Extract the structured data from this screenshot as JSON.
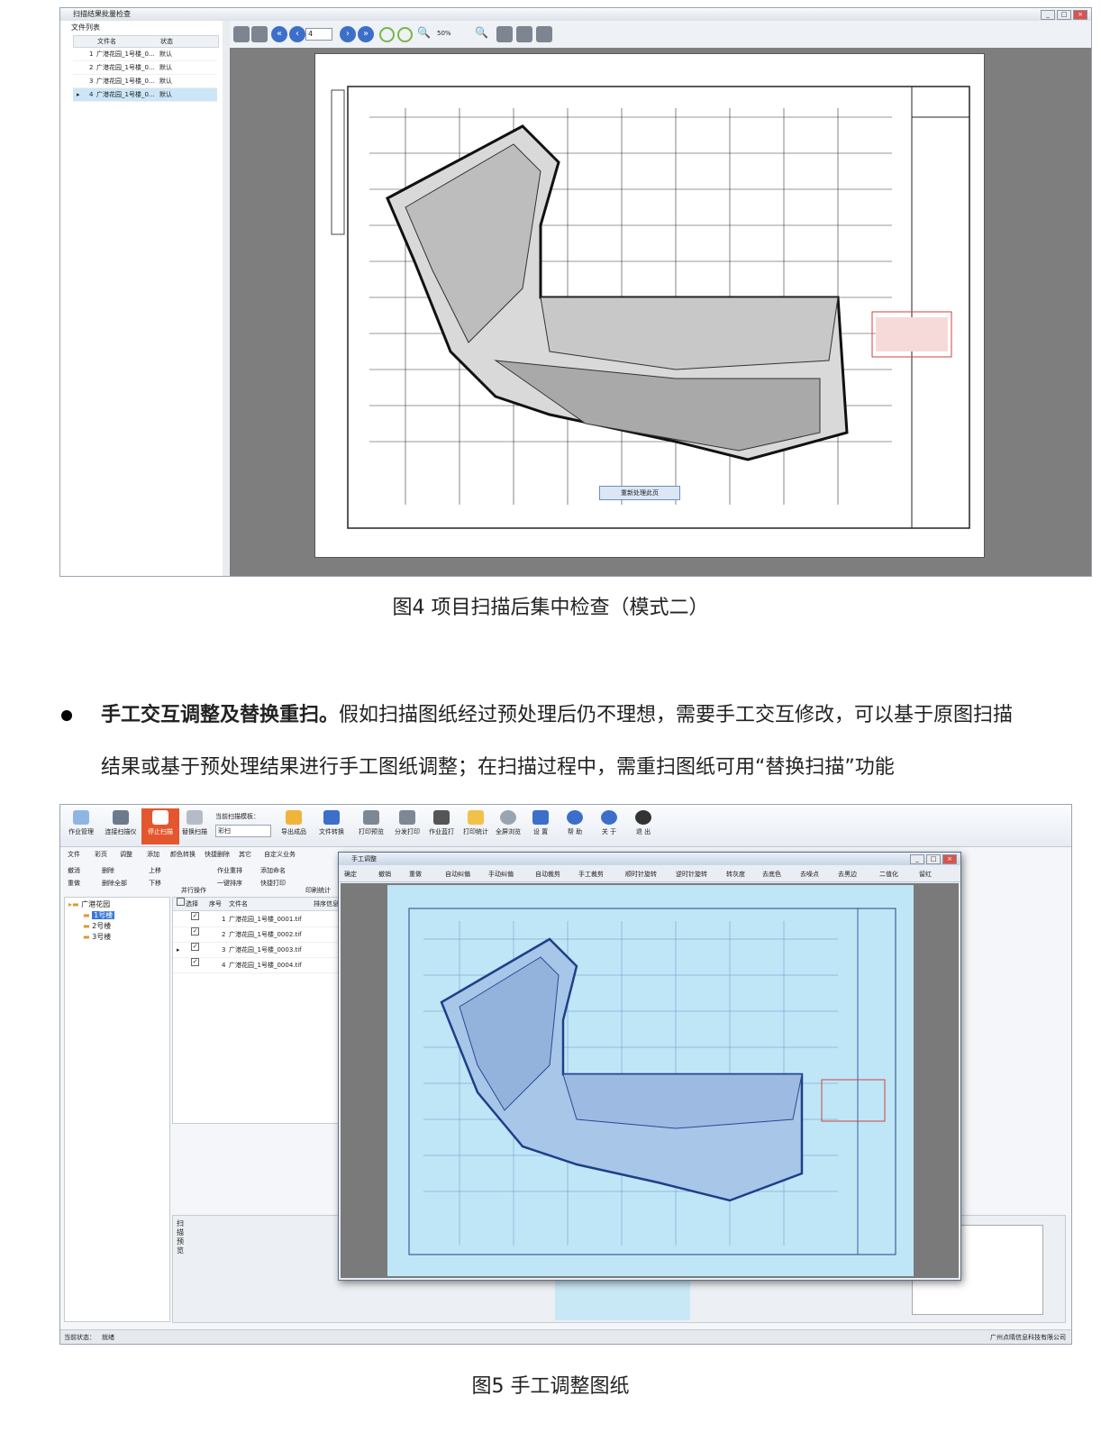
{
  "figure4": {
    "window_title": "扫描结果批量检查",
    "file_list_title": "文件列表",
    "columns": [
      "文件名",
      "状态"
    ],
    "rows": [
      {
        "no": "1",
        "name": "广港花园_1号楼_0...",
        "status": "默认"
      },
      {
        "no": "2",
        "name": "广港花园_1号楼_0...",
        "status": "默认"
      },
      {
        "no": "3",
        "name": "广港花园_1号楼_0...",
        "status": "默认"
      },
      {
        "no": "4",
        "name": "广港花园_1号楼_0...",
        "status": "默认"
      }
    ],
    "page_number": "4",
    "zoom": "50%",
    "context_button": "重新处理此页",
    "caption": "图4  项目扫描后集中检查（模式二）"
  },
  "paragraph": {
    "bold": "手工交互调整及替换重扫。",
    "line1": "假如扫描图纸经过预处理后仍不理想，需要手工交互修改，可以基于原图扫描",
    "line2": "结果或基于预处理结果进行手工图纸调整；在扫描过程中，需重扫图纸可用“替换扫描”功能"
  },
  "figure5": {
    "ribbon": [
      "作业管理",
      "连接扫描仪",
      "停止扫描",
      "替换扫描",
      "当前扫描模板：",
      "导出成品",
      "文件转换",
      "打印预览",
      "分发打印",
      "作业蓝打",
      "打印统计",
      "全屏浏览",
      "设 置",
      "帮 助",
      "关 于",
      "退 出"
    ],
    "template_value": "彩扫",
    "menu": [
      "文件",
      "彩页",
      "调整",
      "添加",
      "颜色转换",
      "快捷删除",
      "其它",
      "自定义业务"
    ],
    "ops": [
      "撤消",
      "删除",
      "上移",
      "作业重排",
      "添加命名",
      "重做",
      "删除全部",
      "下移",
      "并行操作",
      "一键排序",
      "快捷打印",
      "印刷统计"
    ],
    "tree": {
      "root": "广港花园",
      "children": [
        "1号楼",
        "2号楼",
        "3号楼"
      ]
    },
    "grid_columns": [
      "选择",
      "序号",
      "文件名",
      "排序信息"
    ],
    "files": [
      {
        "no": "1",
        "name": "广港花园_1号楼_0001.tif"
      },
      {
        "no": "2",
        "name": "广港花园_1号楼_0002.tif"
      },
      {
        "no": "3",
        "name": "广港花园_1号楼_0003.tif"
      },
      {
        "no": "4",
        "name": "广港花园_1号楼_0004.tif"
      }
    ],
    "preview_label": "扫描预览",
    "dialog_title": "手工调整",
    "dialog_tools": [
      "确定",
      "撤销",
      "重做",
      "自动纠偏",
      "手动纠偏",
      "自动裁剪",
      "手工裁剪",
      "顺时针旋转",
      "逆时针旋转",
      "转灰度",
      "去底色",
      "去噪点",
      "去黑边",
      "二值化",
      "留红"
    ],
    "status_label": "当前状态：",
    "status_value": "就绪",
    "company": "广州点晴信息科技有限公司",
    "caption": "图5  手工调整图纸"
  },
  "colors": {
    "accent": "#e4572e",
    "selection": "#3b78d8",
    "blueprint": "#bfe6f6"
  }
}
